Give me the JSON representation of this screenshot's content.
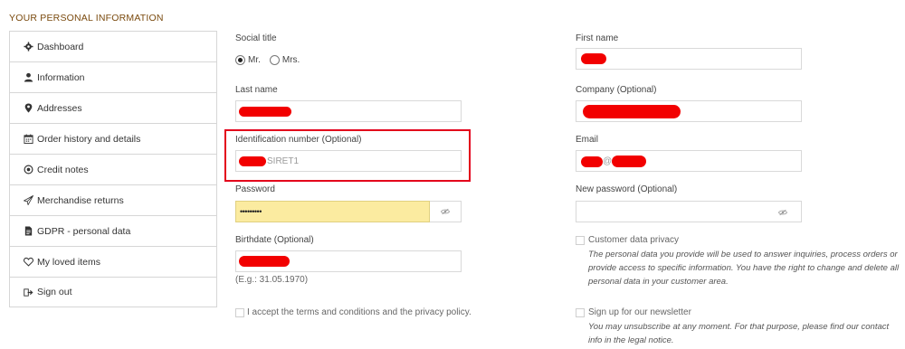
{
  "page": {
    "title": "YOUR PERSONAL INFORMATION"
  },
  "sidebar": {
    "items": [
      {
        "label": "Dashboard",
        "icon": "gear-icon"
      },
      {
        "label": "Information",
        "icon": "user-icon"
      },
      {
        "label": "Addresses",
        "icon": "map-pin-icon"
      },
      {
        "label": "Order history and details",
        "icon": "calendar-icon"
      },
      {
        "label": "Credit notes",
        "icon": "circle-dot-icon"
      },
      {
        "label": "Merchandise returns",
        "icon": "send-icon"
      },
      {
        "label": "GDPR - personal data",
        "icon": "document-icon"
      },
      {
        "label": "My loved items",
        "icon": "heart-icon"
      },
      {
        "label": "Sign out",
        "icon": "sign-out-icon"
      }
    ]
  },
  "form": {
    "social_title": {
      "label": "Social title",
      "options": [
        {
          "label": "Mr.",
          "selected": true
        },
        {
          "label": "Mrs.",
          "selected": false
        }
      ]
    },
    "first_name": {
      "label": "First name"
    },
    "last_name": {
      "label": "Last name"
    },
    "company": {
      "label": "Company (Optional)"
    },
    "identification": {
      "label": "Identification number (Optional)",
      "value_visible": "SIRET1"
    },
    "email": {
      "label": "Email",
      "value_visible": "@"
    },
    "password": {
      "label": "Password",
      "value": "•••••••••"
    },
    "new_password": {
      "label": "New password (Optional)"
    },
    "birthdate": {
      "label": "Birthdate (Optional)",
      "hint": "(E.g.: 31.05.1970)"
    },
    "customer_privacy": {
      "label": "Customer data privacy",
      "text": "The personal data you provide will be used to answer inquiries, process orders or provide access to specific information. You have the right to change and delete all personal data in your customer area."
    },
    "terms": {
      "label": "I accept the terms and conditions and the privacy policy."
    },
    "newsletter": {
      "label": "Sign up for our newsletter",
      "text": "You may unsubscribe at any moment. For that purpose, please find our contact info in the legal notice."
    }
  },
  "colors": {
    "title": "#7a4a0e",
    "redaction": "#f20000",
    "highlight": "#e3001b",
    "autofill": "#fbeba0"
  }
}
